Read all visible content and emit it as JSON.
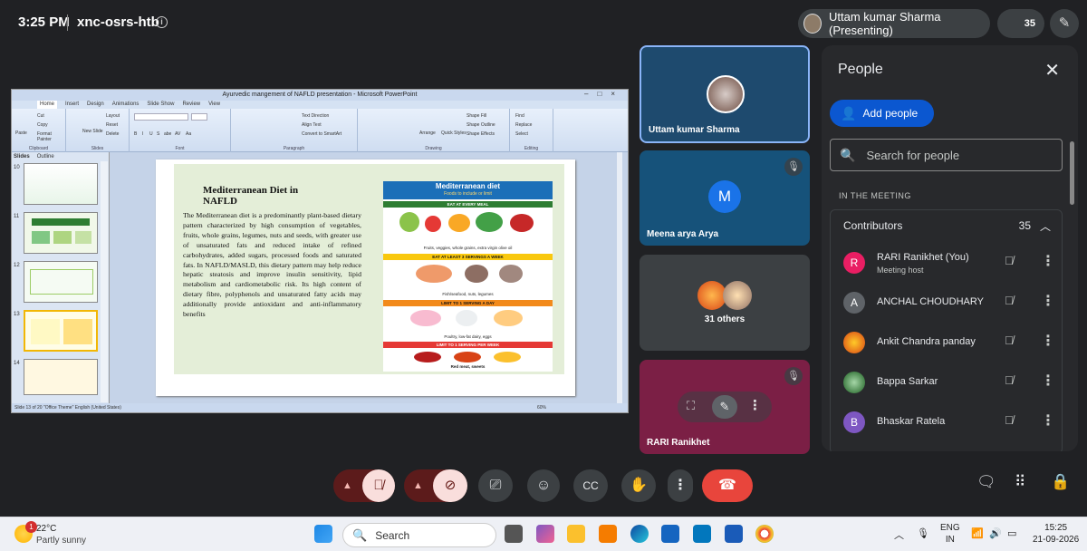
{
  "topbar": {
    "time": "3:25 PM",
    "meeting_code": "xnc-osrs-htb",
    "info_icon": "i",
    "presenter": "Uttam kumar Sharma (Presenting)",
    "participant_count": "35"
  },
  "powerpoint": {
    "title": "Ayurvedic mangement of NAFLD presentation - Microsoft PowerPoint",
    "tabs": [
      "Home",
      "Insert",
      "Design",
      "Animations",
      "Slide Show",
      "Review",
      "View"
    ],
    "groups": {
      "clipboard": {
        "label": "Clipboard",
        "items": [
          "Cut",
          "Copy",
          "Paste",
          "Format Painter"
        ]
      },
      "slides": {
        "label": "Slides",
        "items": [
          "Layout",
          "Reset",
          "New Slide",
          "Delete"
        ]
      },
      "font": {
        "label": "Font",
        "items": [
          "B",
          "I",
          "U",
          "S",
          "abe",
          "AV",
          "Aa"
        ]
      },
      "paragraph": {
        "label": "Paragraph",
        "items": [
          "Text Direction",
          "Align Text",
          "Convert to SmartArt"
        ]
      },
      "drawing": {
        "label": "Drawing",
        "items": [
          "Arrange",
          "Quick Styles",
          "Shape Fill",
          "Shape Outline",
          "Shape Effects"
        ]
      },
      "editing": {
        "label": "Editing",
        "items": [
          "Find",
          "Replace",
          "Select"
        ]
      }
    },
    "side_tabs": [
      "Slides",
      "Outline"
    ],
    "thumbnails": [
      {
        "num": "10"
      },
      {
        "num": "11"
      },
      {
        "num": "12"
      },
      {
        "num": "13"
      },
      {
        "num": "14"
      }
    ],
    "slide": {
      "title": "Mediterranean Diet in NAFLD",
      "body": "The Mediterranean diet is a predominantly plant-based dietary pattern characterized by high consumption of vegetables, fruits, whole grains, legumes, nuts and seeds, with greater use of unsaturated fats and reduced intake of refined carbohydrates, added sugars, processed foods and saturated fats. In NAFLD/MASLD, this dietary pattern may help reduce hepatic steatosis and improve insulin sensitivity, lipid metabolism and cardiometabolic risk. Its high content of dietary fibre, polyphenols and unsaturated fatty acids may additionally provide antioxidant and anti-inflammatory benefits",
      "diet_title": "Mediterranean diet",
      "diet_subtitle": "Foods to include or limit",
      "bands": [
        {
          "label": "EAT AT EVERY MEAL",
          "food": "Fruits, veggies, whole grains, extra virgin olive oil",
          "color": "#2e7d32"
        },
        {
          "label": "EAT AT LEAST 3 SERVINGS A WEEK",
          "food": "Fish/seafood, nuts, legumes",
          "color": "#f9c80e"
        },
        {
          "label": "LIMIT TO 1 SERVING A DAY",
          "food": "Poultry, low-fat dairy, eggs",
          "color": "#f28a1b"
        },
        {
          "label": "LIMIT TO 1 SERVING PER WEEK",
          "food": "Red meat, sweets",
          "color": "#e53935"
        }
      ]
    },
    "status": "Slide 13 of 20   \"Office Theme\"   English (United States)",
    "zoom": "60%"
  },
  "tiles": {
    "presenter_name": "Uttam kumar Sharma",
    "meena_initial": "M",
    "meena_name": "Meena arya Arya",
    "others": "31 others",
    "rari_name": "RARI Ranikhet"
  },
  "people": {
    "title": "People",
    "add_label": "Add people",
    "search_placeholder": "Search for people",
    "section": "IN THE MEETING",
    "contributors_label": "Contributors",
    "contributors_count": "35",
    "list": [
      {
        "initial": "R",
        "name": "RARI Ranikhet (You)",
        "sub": "Meeting host",
        "color": "#e91e63"
      },
      {
        "initial": "A",
        "name": "ANCHAL CHOUDHARY",
        "sub": "",
        "color": "#5f6368"
      },
      {
        "initial": "",
        "name": "Ankit Chandra panday",
        "sub": "",
        "color": "#d84315"
      },
      {
        "initial": "",
        "name": "Bappa Sarkar",
        "sub": "",
        "color": "#2e7d32"
      },
      {
        "initial": "B",
        "name": "Bhaskar Ratela",
        "sub": "",
        "color": "#7e57c2"
      }
    ]
  },
  "taskbar": {
    "weather_temp": "22°C",
    "weather_desc": "Partly sunny",
    "weather_badge": "1",
    "search": "Search",
    "lang1": "ENG",
    "lang2": "IN",
    "time": "15:25",
    "date": "21-09-2026"
  }
}
